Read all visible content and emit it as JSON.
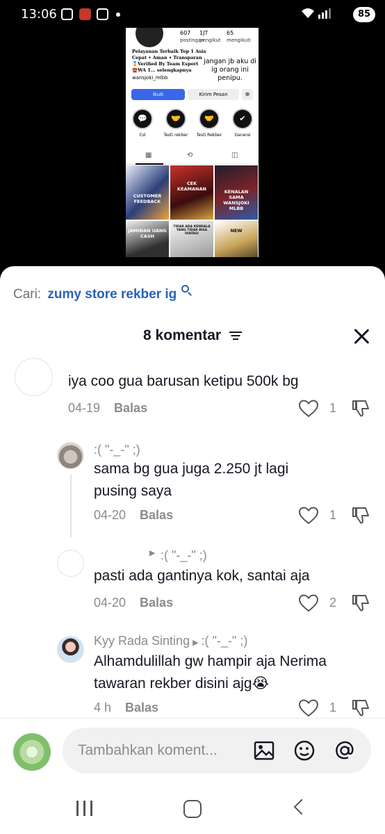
{
  "status_bar": {
    "time": "13:06",
    "battery": "85"
  },
  "preview": {
    "stats": [
      {
        "value": "607",
        "label": "postingan"
      },
      {
        "value": "1JT",
        "label": "pengikut"
      },
      {
        "value": "65",
        "label": "mengikuti"
      }
    ],
    "bio_lines": [
      "Pelayanan Terbaik Top 1 Asia",
      "Cepat • Aman • Transparan",
      "🏅Verified By Team Esport",
      "☎️WA 1... selengkapnya"
    ],
    "handle": "wansjoki_mlbb",
    "overlay_text": "jangan jb aku di ig orang ini penipu.",
    "follow_label": "Ikuti",
    "message_label": "Kirim Pesan",
    "highlights": [
      "Csl",
      "Testi rekber",
      "Testi Rekber",
      "Garansi"
    ],
    "posts": [
      "CUSTOMER FEEDBACK",
      "CEK KEAMANAN",
      "KENALAN SAMA WANSJOKI MLBB",
      "JAMINAN UANG CASH",
      "TIDAK ADA KENDALA YANG TIDAK BISA DIATASI",
      "NEW"
    ]
  },
  "sheet": {
    "search_label": "Cari:",
    "search_query": "zumy store rekber ig",
    "header_title": "8 komentar",
    "reply_label": "Balas",
    "composer_placeholder": "Tambahkan koment..."
  },
  "comments": [
    {
      "username": "",
      "reply_to": "",
      "text": [
        "iya coo gua barusan ketipu 500k bg"
      ],
      "date": "04-19",
      "likes": "1"
    },
    {
      "username": ":( \"-_-\" ;)",
      "reply_to": "",
      "text": [
        "sama bg gua juga 2.250 jt lagi",
        "pusing saya"
      ],
      "date": "04-20",
      "likes": "1"
    },
    {
      "username": "",
      "reply_to": ":( \"-_-\" ;)",
      "text": [
        "pasti ada gantinya kok, santai aja"
      ],
      "date": "04-20",
      "likes": "2"
    },
    {
      "username": "Kyy Rada Sinting",
      "reply_to": ":( \"-_-\" ;)",
      "text": [
        "Alhamdulillah gw hampir aja Nerima",
        "tawaran rekber disini ajg😭"
      ],
      "date": "4 h",
      "likes": "1"
    }
  ],
  "colors": {
    "accent_link": "#2a62b6",
    "muted_text": "#8a8b91",
    "primary_text": "#161823",
    "follow_button": "#3a66e8"
  },
  "icons": [
    "filter-icon",
    "close-icon",
    "heart-icon",
    "dislike-icon",
    "image-icon",
    "emoji-icon",
    "mention-icon",
    "search-icon"
  ]
}
